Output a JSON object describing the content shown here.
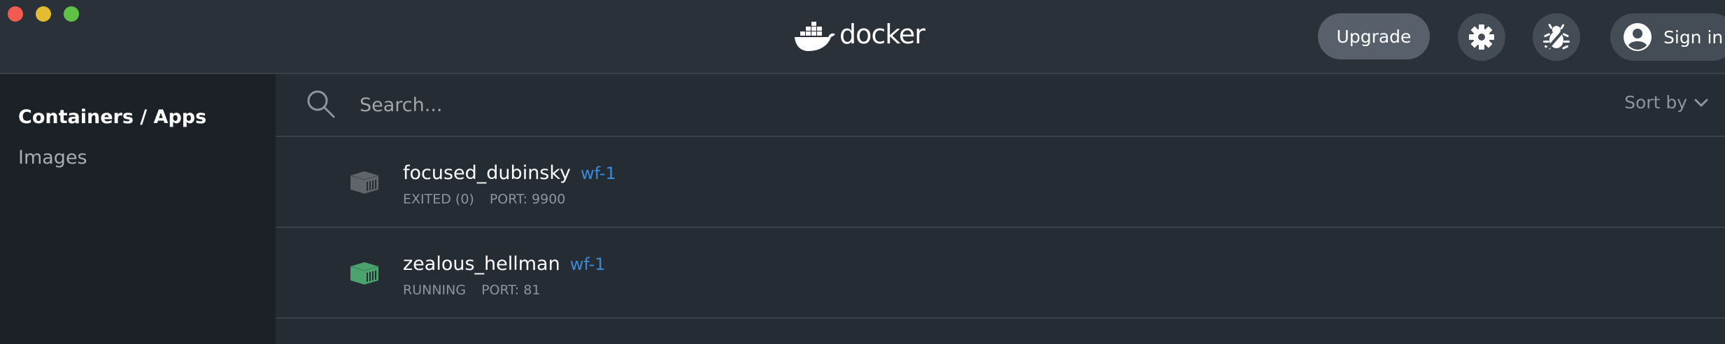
{
  "window": {
    "brand": "docker"
  },
  "header": {
    "upgrade_label": "Upgrade",
    "signin_label": "Sign in"
  },
  "sidebar": {
    "items": [
      {
        "label": "Containers / Apps",
        "active": true
      },
      {
        "label": "Images",
        "active": false
      }
    ]
  },
  "search": {
    "placeholder": "Search...",
    "value": "",
    "sort_label": "Sort by"
  },
  "containers": [
    {
      "name": "focused_dubinsky",
      "tag": "wf-1",
      "status": "EXITED (0)",
      "port": "PORT: 9900",
      "state": "exited",
      "icon": "container-icon",
      "color": "#5f656b"
    },
    {
      "name": "zealous_hellman",
      "tag": "wf-1",
      "status": "RUNNING",
      "port": "PORT: 81",
      "state": "running",
      "icon": "container-icon",
      "color": "#4ca36d"
    }
  ],
  "colors": {
    "accent_tag": "#3c8bd8",
    "running": "#4ca36d",
    "exited": "#5f656b"
  }
}
